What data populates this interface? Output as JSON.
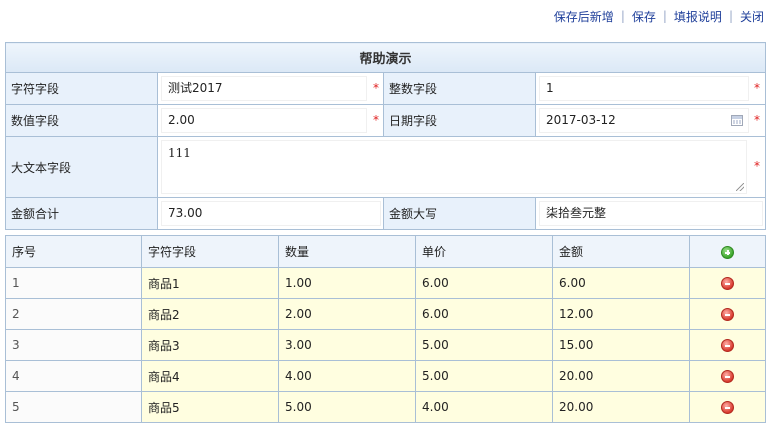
{
  "toolbar": {
    "save_and_new": "保存后新增",
    "save": "保存",
    "help": "填报说明",
    "close": "关闭"
  },
  "form": {
    "title": "帮助演示",
    "text_field": {
      "label": "字符字段",
      "value": "测试2017",
      "required": "*"
    },
    "int_field": {
      "label": "整数字段",
      "value": "1",
      "required": "*"
    },
    "num_field": {
      "label": "数值字段",
      "value": "2.00",
      "required": "*"
    },
    "date_field": {
      "label": "日期字段",
      "value": "2017-03-12",
      "required": "*"
    },
    "bigtext_field": {
      "label": "大文本字段",
      "value": "111",
      "required": "*"
    },
    "amount_total": {
      "label": "金额合计",
      "value": "73.00"
    },
    "amount_upper": {
      "label": "金额大写",
      "value": "柒拾叁元整"
    }
  },
  "grid": {
    "headers": [
      "序号",
      "字符字段",
      "数量",
      "单价",
      "金额"
    ],
    "rows": [
      {
        "seq": "1",
        "name": "商品1",
        "qty": "1.00",
        "price": "6.00",
        "amount": "6.00"
      },
      {
        "seq": "2",
        "name": "商品2",
        "qty": "2.00",
        "price": "6.00",
        "amount": "12.00"
      },
      {
        "seq": "3",
        "name": "商品3",
        "qty": "3.00",
        "price": "5.00",
        "amount": "15.00"
      },
      {
        "seq": "4",
        "name": "商品4",
        "qty": "4.00",
        "price": "5.00",
        "amount": "20.00"
      },
      {
        "seq": "5",
        "name": "商品5",
        "qty": "5.00",
        "price": "4.00",
        "amount": "20.00"
      }
    ]
  },
  "icons": {
    "add_row": "plus-circle-icon",
    "delete_row": "minus-circle-icon",
    "calendar": "calendar-icon"
  },
  "colors": {
    "accent": "#1f3f9a",
    "border": "#a9bfd6",
    "label_bg": "#e8f1fb",
    "row_bg": "#fffee0",
    "required": "#e02020"
  }
}
